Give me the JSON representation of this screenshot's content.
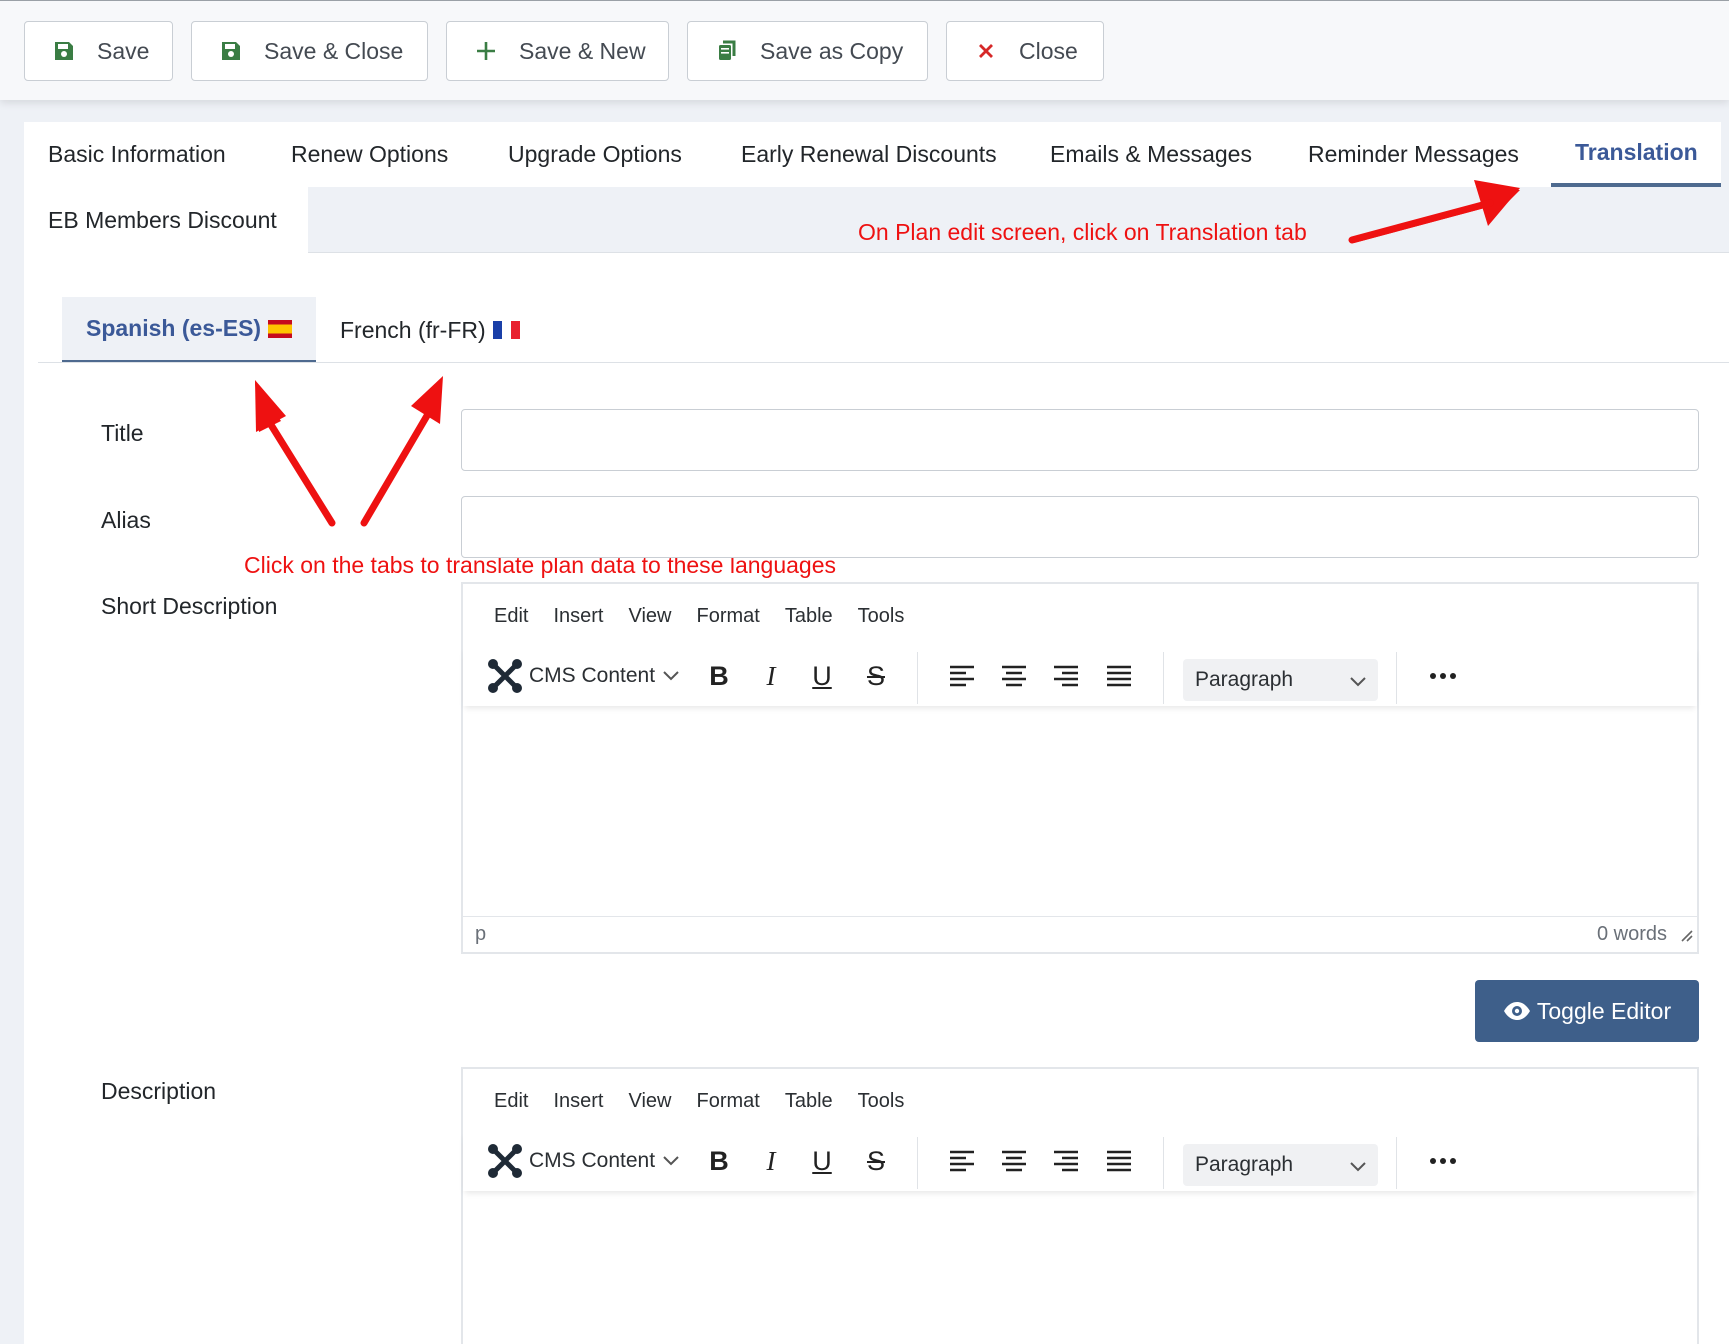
{
  "toolbar": {
    "buttons": [
      {
        "label": "Save",
        "icon": "save-icon"
      },
      {
        "label": "Save & Close",
        "icon": "save-icon"
      },
      {
        "label": "Save & New",
        "icon": "plus-icon"
      },
      {
        "label": "Save as Copy",
        "icon": "copy-icon"
      },
      {
        "label": "Close",
        "icon": "close-icon"
      }
    ]
  },
  "tabs": [
    {
      "label": "Basic Information"
    },
    {
      "label": "Renew Options"
    },
    {
      "label": "Upgrade Options"
    },
    {
      "label": "Early Renewal Discounts"
    },
    {
      "label": "Emails & Messages"
    },
    {
      "label": "Reminder Messages"
    },
    {
      "label": "Translation",
      "active": true
    },
    {
      "label": "EB Members Discount"
    }
  ],
  "annotations": {
    "translation_tab": "On Plan edit screen, click on Translation tab",
    "language_tabs": "Click on the tabs to translate plan data to these languages"
  },
  "language_tabs": [
    {
      "label": "Spanish (es-ES)",
      "flag": "flag-es-icon",
      "active": true
    },
    {
      "label": "French (fr-FR)",
      "flag": "flag-fr-icon"
    }
  ],
  "form": {
    "title_label": "Title",
    "title_value": "",
    "alias_label": "Alias",
    "alias_value": "",
    "short_description_label": "Short Description",
    "description_label": "Description"
  },
  "editor": {
    "menu": [
      "Edit",
      "Insert",
      "View",
      "Format",
      "Table",
      "Tools"
    ],
    "cms_content_label": "CMS Content",
    "block_format": "Paragraph",
    "status_path": "p",
    "word_count": "0 words",
    "toggle_label": "Toggle Editor"
  },
  "colors": {
    "primary": "#3e5f8a",
    "active_tab": "#3b5998",
    "annotation": "#ee1111",
    "save_icon": "#3a7d44",
    "close_icon": "#d62828"
  }
}
